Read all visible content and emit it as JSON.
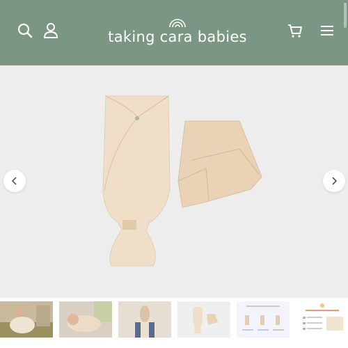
{
  "header": {
    "brand": "taking cara babies",
    "icons": [
      "search-icon",
      "account-icon",
      "cart-icon",
      "menu-icon"
    ],
    "background": "#7b9784"
  },
  "gallery": {
    "main_image": "swaddle sack and wrap product",
    "prev_icon": "chevron-left-icon",
    "next_icon": "chevron-right-icon",
    "thumbnails": [
      {
        "name": "thumb-parent-holding-baby"
      },
      {
        "name": "thumb-baby-on-bed"
      },
      {
        "name": "thumb-baby-held-up"
      },
      {
        "name": "thumb-product-flatlay"
      },
      {
        "name": "thumb-instructions"
      },
      {
        "name": "thumb-included-list"
      }
    ]
  }
}
